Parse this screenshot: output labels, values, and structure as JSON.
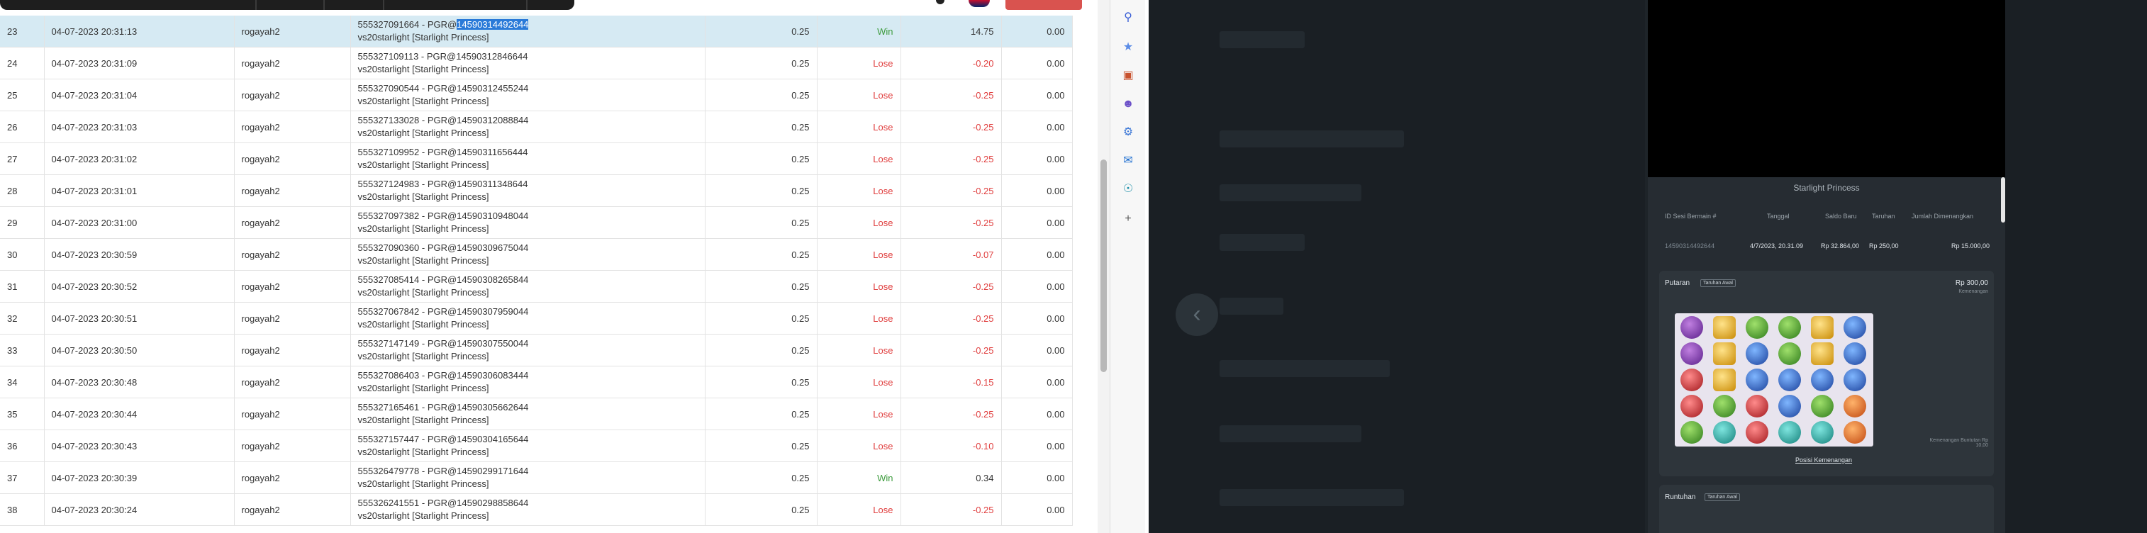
{
  "rows": [
    {
      "no": "23",
      "date": "04-07-2023 20:31:13",
      "user": "rogayah2",
      "tx_pre": "555327091664 - PGR@",
      "tx_sel": "14590314492644",
      "game": "vs20starlight [Starlight Princess]",
      "bet": "0.25",
      "status": "Win",
      "amount": "14.75",
      "extra": "0.00"
    },
    {
      "no": "24",
      "date": "04-07-2023 20:31:09",
      "user": "rogayah2",
      "tx_pre": "555327109113 - PGR@14590312846644",
      "tx_sel": "",
      "game": "vs20starlight [Starlight Princess]",
      "bet": "0.25",
      "status": "Lose",
      "amount": "-0.20",
      "extra": "0.00"
    },
    {
      "no": "25",
      "date": "04-07-2023 20:31:04",
      "user": "rogayah2",
      "tx_pre": "555327090544 - PGR@14590312455244",
      "tx_sel": "",
      "game": "vs20starlight [Starlight Princess]",
      "bet": "0.25",
      "status": "Lose",
      "amount": "-0.25",
      "extra": "0.00"
    },
    {
      "no": "26",
      "date": "04-07-2023 20:31:03",
      "user": "rogayah2",
      "tx_pre": "555327133028 - PGR@14590312088844",
      "tx_sel": "",
      "game": "vs20starlight [Starlight Princess]",
      "bet": "0.25",
      "status": "Lose",
      "amount": "-0.25",
      "extra": "0.00"
    },
    {
      "no": "27",
      "date": "04-07-2023 20:31:02",
      "user": "rogayah2",
      "tx_pre": "555327109952 - PGR@14590311656444",
      "tx_sel": "",
      "game": "vs20starlight [Starlight Princess]",
      "bet": "0.25",
      "status": "Lose",
      "amount": "-0.25",
      "extra": "0.00"
    },
    {
      "no": "28",
      "date": "04-07-2023 20:31:01",
      "user": "rogayah2",
      "tx_pre": "555327124983 - PGR@14590311348644",
      "tx_sel": "",
      "game": "vs20starlight [Starlight Princess]",
      "bet": "0.25",
      "status": "Lose",
      "amount": "-0.25",
      "extra": "0.00"
    },
    {
      "no": "29",
      "date": "04-07-2023 20:31:00",
      "user": "rogayah2",
      "tx_pre": "555327097382 - PGR@14590310948044",
      "tx_sel": "",
      "game": "vs20starlight [Starlight Princess]",
      "bet": "0.25",
      "status": "Lose",
      "amount": "-0.25",
      "extra": "0.00"
    },
    {
      "no": "30",
      "date": "04-07-2023 20:30:59",
      "user": "rogayah2",
      "tx_pre": "555327090360 - PGR@14590309675044",
      "tx_sel": "",
      "game": "vs20starlight [Starlight Princess]",
      "bet": "0.25",
      "status": "Lose",
      "amount": "-0.07",
      "extra": "0.00"
    },
    {
      "no": "31",
      "date": "04-07-2023 20:30:52",
      "user": "rogayah2",
      "tx_pre": "555327085414 - PGR@14590308265844",
      "tx_sel": "",
      "game": "vs20starlight [Starlight Princess]",
      "bet": "0.25",
      "status": "Lose",
      "amount": "-0.25",
      "extra": "0.00"
    },
    {
      "no": "32",
      "date": "04-07-2023 20:30:51",
      "user": "rogayah2",
      "tx_pre": "555327067842 - PGR@14590307959044",
      "tx_sel": "",
      "game": "vs20starlight [Starlight Princess]",
      "bet": "0.25",
      "status": "Lose",
      "amount": "-0.25",
      "extra": "0.00"
    },
    {
      "no": "33",
      "date": "04-07-2023 20:30:50",
      "user": "rogayah2",
      "tx_pre": "555327147149 - PGR@14590307550044",
      "tx_sel": "",
      "game": "vs20starlight [Starlight Princess]",
      "bet": "0.25",
      "status": "Lose",
      "amount": "-0.25",
      "extra": "0.00"
    },
    {
      "no": "34",
      "date": "04-07-2023 20:30:48",
      "user": "rogayah2",
      "tx_pre": "555327086403 - PGR@14590306083444",
      "tx_sel": "",
      "game": "vs20starlight [Starlight Princess]",
      "bet": "0.25",
      "status": "Lose",
      "amount": "-0.15",
      "extra": "0.00"
    },
    {
      "no": "35",
      "date": "04-07-2023 20:30:44",
      "user": "rogayah2",
      "tx_pre": "555327165461 - PGR@14590305662644",
      "tx_sel": "",
      "game": "vs20starlight [Starlight Princess]",
      "bet": "0.25",
      "status": "Lose",
      "amount": "-0.25",
      "extra": "0.00"
    },
    {
      "no": "36",
      "date": "04-07-2023 20:30:43",
      "user": "rogayah2",
      "tx_pre": "555327157447 - PGR@14590304165644",
      "tx_sel": "",
      "game": "vs20starlight [Starlight Princess]",
      "bet": "0.25",
      "status": "Lose",
      "amount": "-0.10",
      "extra": "0.00"
    },
    {
      "no": "37",
      "date": "04-07-2023 20:30:39",
      "user": "rogayah2",
      "tx_pre": "555326479778 - PGR@14590299171644",
      "tx_sel": "",
      "game": "vs20starlight [Starlight Princess]",
      "bet": "0.25",
      "status": "Win",
      "amount": "0.34",
      "extra": "0.00"
    },
    {
      "no": "38",
      "date": "04-07-2023 20:30:24",
      "user": "rogayah2",
      "tx_pre": "555326241551 - PGR@14590298858644",
      "tx_sel": "",
      "game": "vs20starlight [Starlight Princess]",
      "bet": "0.25",
      "status": "Lose",
      "amount": "-0.25",
      "extra": "0.00"
    }
  ],
  "sidebar_icons": [
    "search-icon",
    "tag-icon",
    "briefcase-icon",
    "users-icon",
    "settings-icon",
    "outlook-icon",
    "cart-icon",
    "plus-icon"
  ],
  "detail": {
    "title": "Starlight Princess",
    "headers": {
      "session": "ID Sesi Bermain #",
      "date": "Tanggal",
      "balance": "Saldo Baru",
      "bet": "Taruhan",
      "win": "Jumlah Dimenangkan"
    },
    "values": {
      "session": "14590314492644",
      "date": "4/7/2023, 20.31.09",
      "balance": "Rp 32.864,00",
      "bet": "Rp 250,00",
      "win": "Rp 15.000,00"
    },
    "spin_label": "Putaran",
    "spin_tag": "Taruhan Awal",
    "spin_amount": "Rp 300,00",
    "spin_amount_sub": "Kemenangan",
    "win_line": "Posisi Kemenangan",
    "win_note": "Kemenangan Buntutan Rp 10,00",
    "cascade_label": "Runtuhan",
    "cascade_tag": "Taruhan Awal"
  },
  "gems": [
    [
      "purple",
      "yellow",
      "green",
      "green",
      "yellow",
      "blue"
    ],
    [
      "purple",
      "yellow",
      "blue",
      "green",
      "yellow",
      "blue"
    ],
    [
      "red",
      "yellow",
      "blue",
      "blue",
      "blue",
      "blue"
    ],
    [
      "red",
      "green",
      "red",
      "blue",
      "green",
      "orange"
    ],
    [
      "green",
      "teal",
      "red",
      "teal",
      "teal",
      "orange"
    ]
  ]
}
